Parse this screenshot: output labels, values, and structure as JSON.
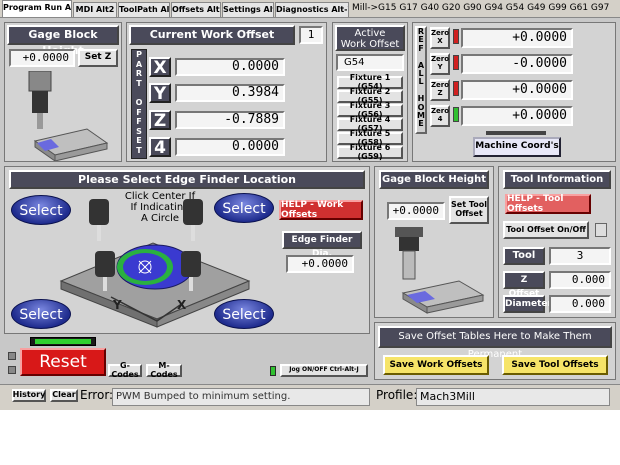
{
  "tabs": [
    {
      "label": "Program Run Alt-1"
    },
    {
      "label": "MDI Alt2"
    },
    {
      "label": "ToolPath Alt4"
    },
    {
      "label": "Offsets Alt5"
    },
    {
      "label": "Settings Alt6"
    },
    {
      "label": "Diagnostics Alt-7"
    }
  ],
  "modal_codes": "Mill->G15  G17 G40 G20 G90 G94 G54 G49 G99 G61 G97",
  "gage_left": {
    "title": "Gage Block Height",
    "value": "+0.0000",
    "set_z": "Set Z"
  },
  "work_offset": {
    "title": "Current Work Offset",
    "offset_num": "1",
    "side_label": [
      "P",
      "A",
      "R",
      "T",
      "",
      "O",
      "F",
      "F",
      "S",
      "E",
      "T"
    ],
    "rows": [
      {
        "axis": "X",
        "value": "0.0000"
      },
      {
        "axis": "Y",
        "value": "0.3984"
      },
      {
        "axis": "Z",
        "value": "-0.7889"
      },
      {
        "axis": "4",
        "value": "0.0000"
      }
    ]
  },
  "active_offset": {
    "title_line1": "Active",
    "title_line2": "Work Offset",
    "value": "G54",
    "fixtures": [
      "Fixture 1 (G54)",
      "Fixture 2 (G55)",
      "Fixture 3 (G56)",
      "Fixture 4 (G57)",
      "Fixture 5 (G58)",
      "Fixture 6 (G59)"
    ]
  },
  "machine": {
    "ref_label": [
      "R",
      "E",
      "F",
      "",
      "A",
      "L",
      "L",
      "",
      "H",
      "O",
      "M",
      "E"
    ],
    "rows": [
      {
        "label": "Zero\nX",
        "value": "+0.0000",
        "led": "#d02020"
      },
      {
        "label": "Zero\nY",
        "value": "-0.0000",
        "led": "#d02020"
      },
      {
        "label": "Zero\nZ",
        "value": "+0.0000",
        "led": "#d02020"
      },
      {
        "label": "Zero\n4",
        "value": "+0.0000",
        "led": "#30c030"
      }
    ],
    "coords_button": "Machine Coord's"
  },
  "edge_finder": {
    "title": "Please Select Edge Finder Location",
    "hint_line1": "Click Center If",
    "hint_line2": "If Indicating",
    "hint_line3": "A Circle",
    "select": "Select",
    "help_button": "HELP - Work Offsets",
    "dia_label": "Edge Finder Dia.",
    "dia_value": "+0.0000",
    "axis_y": "Y",
    "axis_x": "X"
  },
  "gage_right": {
    "title": "Gage Block Height",
    "value": "+0.0000",
    "set_button": "Set Tool Offset"
  },
  "tool_info": {
    "title": "Tool Information",
    "help_button": "HELP - Tool Offsets",
    "offset_toggle": "Tool Offset On/Off",
    "tool_label": "Tool",
    "tool_value": "3",
    "zoffset_label": "Z Offset",
    "zoffset_value": "0.000",
    "diameter_label": "Diameter",
    "diameter_value": "0.000"
  },
  "save_tables": {
    "title": "Save Offset Tables Here to Make Them Permanent",
    "work": "Save Work Offsets",
    "tool": "Save Tool Offsets"
  },
  "bottom": {
    "reset": "Reset",
    "gcodes": "G-Codes",
    "mcodes": "M-Codes",
    "jog": "Jog ON/OFF Ctrl-Alt-J",
    "history": "History",
    "clear": "Clear",
    "error_label": "Error:",
    "error_text": "PWM Bumped to minimum setting.",
    "profile_label": "Profile:",
    "profile_value": "Mach3Mill"
  },
  "colors": {
    "header": "#4a4a5a",
    "led_red": "#d02020",
    "led_green": "#30c030",
    "select_blue": "#1f2c8e",
    "help_red": "#d03030",
    "save_yellow": "#f6e468"
  }
}
